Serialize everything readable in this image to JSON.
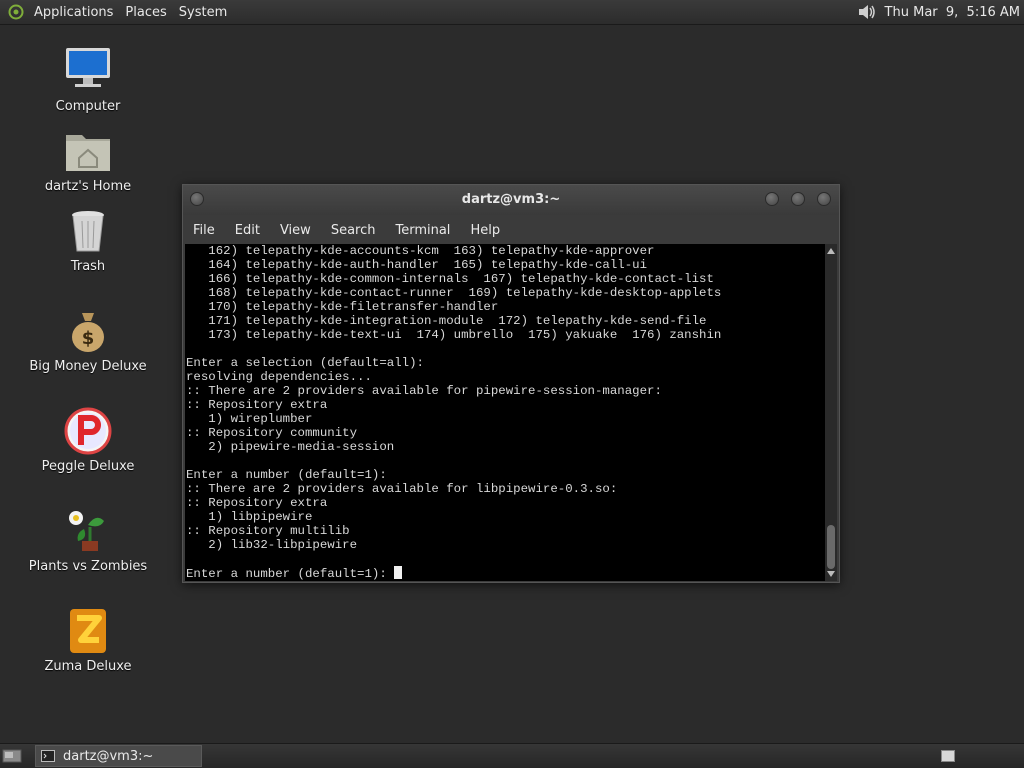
{
  "top_panel": {
    "menus": [
      "Applications",
      "Places",
      "System"
    ],
    "clock": "Thu Mar  9,  5:16 AM",
    "icons": [
      "distro-logo-icon",
      "volume-icon"
    ]
  },
  "desktop": {
    "icons": [
      {
        "label": "Computer",
        "icon": "computer-icon"
      },
      {
        "label": "dartz's Home",
        "icon": "home-folder-icon"
      },
      {
        "label": "Trash",
        "icon": "trash-icon"
      },
      {
        "label": "Big Money Deluxe",
        "icon": "money-bag-icon"
      },
      {
        "label": "Peggle Deluxe",
        "icon": "peggle-icon"
      },
      {
        "label": "Plants vs Zombies",
        "icon": "plants-icon"
      },
      {
        "label": "Zuma Deluxe",
        "icon": "zuma-icon"
      }
    ]
  },
  "terminal": {
    "title": "dartz@vm3:~",
    "menu": [
      "File",
      "Edit",
      "View",
      "Search",
      "Terminal",
      "Help"
    ],
    "lines": [
      "   162) telepathy-kde-accounts-kcm  163) telepathy-kde-approver",
      "   164) telepathy-kde-auth-handler  165) telepathy-kde-call-ui",
      "   166) telepathy-kde-common-internals  167) telepathy-kde-contact-list",
      "   168) telepathy-kde-contact-runner  169) telepathy-kde-desktop-applets",
      "   170) telepathy-kde-filetransfer-handler",
      "   171) telepathy-kde-integration-module  172) telepathy-kde-send-file",
      "   173) telepathy-kde-text-ui  174) umbrello  175) yakuake  176) zanshin",
      "",
      "Enter a selection (default=all):",
      "resolving dependencies...",
      ":: There are 2 providers available for pipewire-session-manager:",
      ":: Repository extra",
      "   1) wireplumber",
      ":: Repository community",
      "   2) pipewire-media-session",
      "",
      "Enter a number (default=1):",
      ":: There are 2 providers available for libpipewire-0.3.so:",
      ":: Repository extra",
      "   1) libpipewire",
      ":: Repository multilib",
      "   2) lib32-libpipewire",
      ""
    ],
    "prompt": "Enter a number (default=1): "
  },
  "taskbar": {
    "task_label": "dartz@vm3:~"
  },
  "colors": {
    "desktop_bg": "#2b2b2b",
    "terminal_bg": "#000000",
    "terminal_fg": "#d8d8d8"
  }
}
